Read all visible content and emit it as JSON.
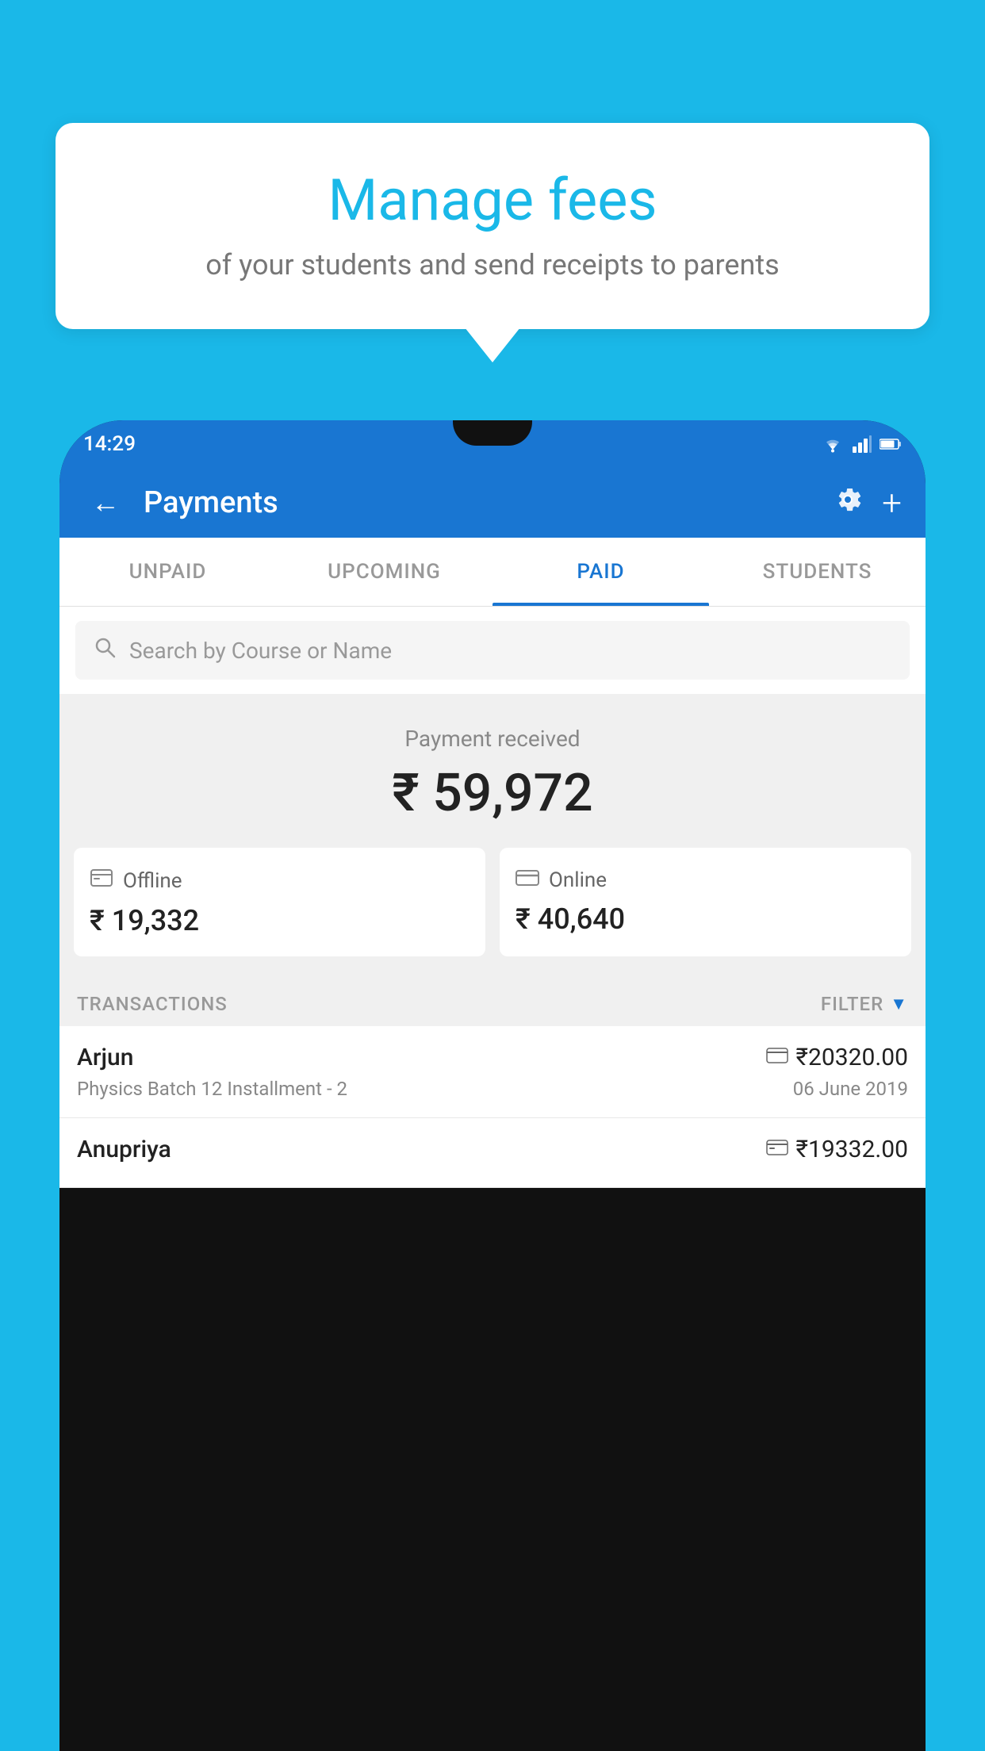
{
  "background_color": "#1ab8e8",
  "speech_bubble": {
    "title": "Manage fees",
    "subtitle": "of your students and send receipts to parents"
  },
  "status_bar": {
    "time": "14:29"
  },
  "app_bar": {
    "title": "Payments",
    "back_label": "←",
    "settings_label": "⚙",
    "add_label": "+"
  },
  "tabs": [
    {
      "label": "UNPAID",
      "active": false
    },
    {
      "label": "UPCOMING",
      "active": false
    },
    {
      "label": "PAID",
      "active": true
    },
    {
      "label": "STUDENTS",
      "active": false
    }
  ],
  "search": {
    "placeholder": "Search by Course or Name"
  },
  "payment_received": {
    "label": "Payment received",
    "amount": "₹ 59,972"
  },
  "payment_cards": [
    {
      "icon": "offline",
      "label": "Offline",
      "amount": "₹ 19,332"
    },
    {
      "icon": "online",
      "label": "Online",
      "amount": "₹ 40,640"
    }
  ],
  "transactions_section": {
    "label": "TRANSACTIONS",
    "filter_label": "FILTER"
  },
  "transactions": [
    {
      "name": "Arjun",
      "course": "Physics Batch 12 Installment - 2",
      "amount": "₹20320.00",
      "date": "06 June 2019",
      "payment_type": "online"
    },
    {
      "name": "Anupriya",
      "course": "",
      "amount": "₹19332.00",
      "date": "",
      "payment_type": "offline"
    }
  ]
}
